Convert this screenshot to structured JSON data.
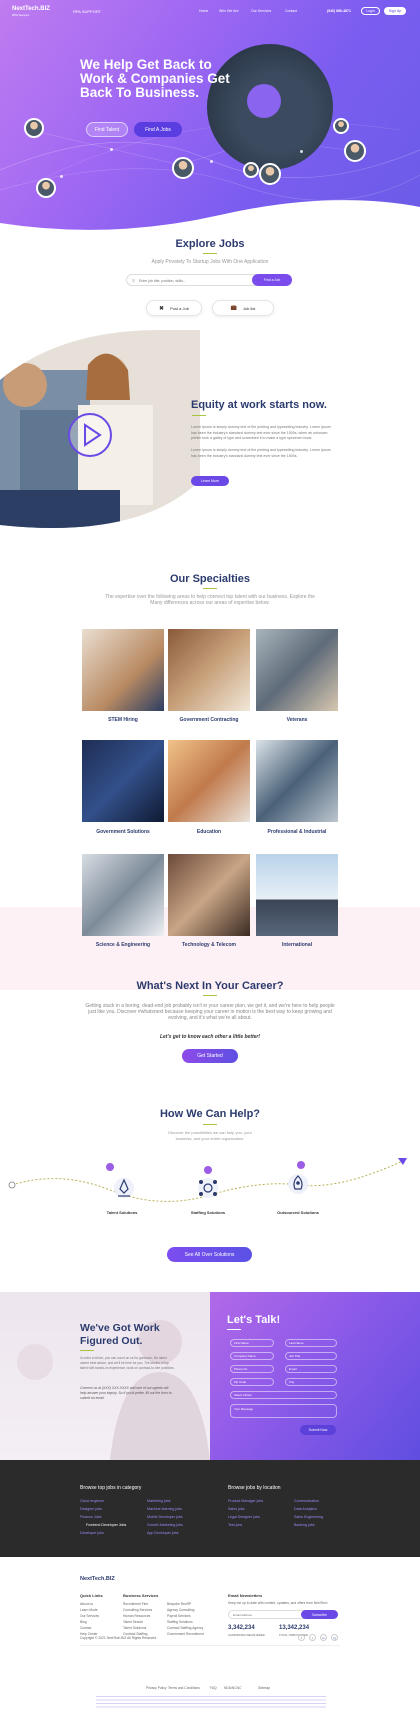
{
  "nav": {
    "logo": "NextTech.BIZ",
    "logo_sub": "RPA Support",
    "logo2": "RPA SUPPORT",
    "links": [
      "Home",
      "Who We Are",
      "Our Services",
      "Contact"
    ],
    "phone": "(540) 680-4871",
    "login": "Login",
    "signup": "Sign Up"
  },
  "hero": {
    "title": "We Help Get Back to Work & Companies Get Back To Business.",
    "btn_talent": "Find Talent",
    "btn_jobs": "Find A Jobs"
  },
  "explore": {
    "title": "Explore Jobs",
    "subtitle": "Apply Privately To Startup Jobs With One Application",
    "search_placeholder": "Enter job title, position, skills...",
    "search_btn": "Find a Job",
    "post_job": "Post a Job",
    "job_list": "Job list"
  },
  "equity": {
    "title": "Equity at work starts now.",
    "para1": "Lorem Ipsum is simply dummy text of the printing and typesetting industry. Lorem Ipsum has been the industry's standard dummy text ever since the 1500s, when an unknown printer took a galley of type and scrambled it to make a type specimen book.",
    "para2": "Lorem Ipsum is simply dummy text of the printing and typesetting industry. Lorem Ipsum has been the industry's standard dummy text ever since the 1500s.",
    "btn": "Learn More"
  },
  "specialties": {
    "title": "Our Specialties",
    "subtitle": "The expertise over the following areas to help connect top talent with our business. Explore the Many differences across our areas of expertise below.",
    "items": [
      "STEM Hiring",
      "Government Contracting",
      "Veterans",
      "Government Solutions",
      "Education",
      "Professional & Industrial",
      "Science & Engineering",
      "Technology & Telecom",
      "International"
    ]
  },
  "career": {
    "title": "What's Next In Your Career?",
    "text": "Getting stuck in a boring, dead-end job probably isn't in your career plan, we get it, and we're here to help people just like you. Discover #whatsnext because keeping your career in motion is the best way to keep growing and evolving, and it's what we're all about.",
    "tagline": "Let's get to know each other a little better!",
    "btn": "Get Started"
  },
  "help": {
    "title": "How We Can Help?",
    "subtitle": "Discover the possibilities we can help you, your business, and your entire organization.",
    "solutions": [
      "Talent Solutions",
      "Staffing Solutions",
      "Outsourced Solutions"
    ],
    "btn": "See All Over Solutions"
  },
  "work": {
    "title": "We've Got Work Figured Out.",
    "para1": "In order to thrive, you can count on us for guidance, the latest career best advice, and we'll be here for you. The stories of top talent with hands-on experience, work on contract-to-hire positions.",
    "para2": "Connect us at (XXX) XXX-XXXX and one of our agents will help answer your inquiry. So if you'd prefer, fill out the form to submit an email."
  },
  "talk": {
    "title": "Let's Talk!",
    "fields": [
      "First Name",
      "Last Name",
      "Company Name",
      "Job Title",
      "Phone No",
      "Email",
      "Zip Code",
      "City",
      "Select Option",
      "Your Message"
    ],
    "submit": "Submit Now"
  },
  "browse": {
    "left_title": "Browse top jobs in category",
    "left_col1": [
      "Cloud engineer",
      "Designer jobs",
      "Finance Jobs",
      "Frontend Developer Jobs",
      "Developer jobs"
    ],
    "left_col2": [
      "Marketing jobs",
      "Machine learning jobs",
      "Mobile Developer jobs",
      "Growth Marketing jobs",
      "App Developer jobs"
    ],
    "right_title": "Browse jobs by location",
    "right_col1": [
      "Product Manager jobs",
      "Sales jobs",
      "Legal Designer jobs",
      "Test jobs"
    ],
    "right_col2": [
      "Communication",
      "Data Analytics",
      "Sales Engineering",
      "Banking jobs"
    ]
  },
  "footer": {
    "logo": "NextTech.BIZ",
    "quick_title": "Quick Links",
    "quick": [
      "About us",
      "Learn Mode",
      "Our Services",
      "Blog",
      "Contact",
      "Help Center"
    ],
    "services_title": "Business Services",
    "services_col1": [
      "Recruitment Firm",
      "Consulting Services",
      "Human Resources",
      "Talent Search",
      "Talent Solutions",
      "Contract Staffing"
    ],
    "services_col2": [
      "Bespoke RecRP",
      "Agency Consulting",
      "Payroll Services",
      "Staffing Solutions",
      "Contract Staffing Agency",
      "Government Recruitment"
    ],
    "newsletter_title": "Email Newsletters",
    "newsletter_text": "Keep me up to date with content, updates, and offers from NextTech",
    "email_placeholder": "Email address",
    "subscribe": "Subscribe",
    "stat1_num": "3,342,234",
    "stat1_label": "CANDIDATES REGISTERED",
    "stat2_num": "13,342,234",
    "stat2_label": "TOTAL JOBS POSTED",
    "copyright": "Copyright © 2021 NextTech.BIZ All Rights Reserved.",
    "bottom_links": [
      "Privacy Policy",
      "Terms and Conditions",
      "FAQ",
      "NDA/NCNC",
      "Sitemap"
    ],
    "social": [
      "f",
      "t",
      "in",
      "ig"
    ]
  },
  "colors": {
    "primary": "#7b4cec",
    "navy": "#2c3b6e",
    "accent": "#a8c43c",
    "dark_footer": "#2b2b2b"
  }
}
